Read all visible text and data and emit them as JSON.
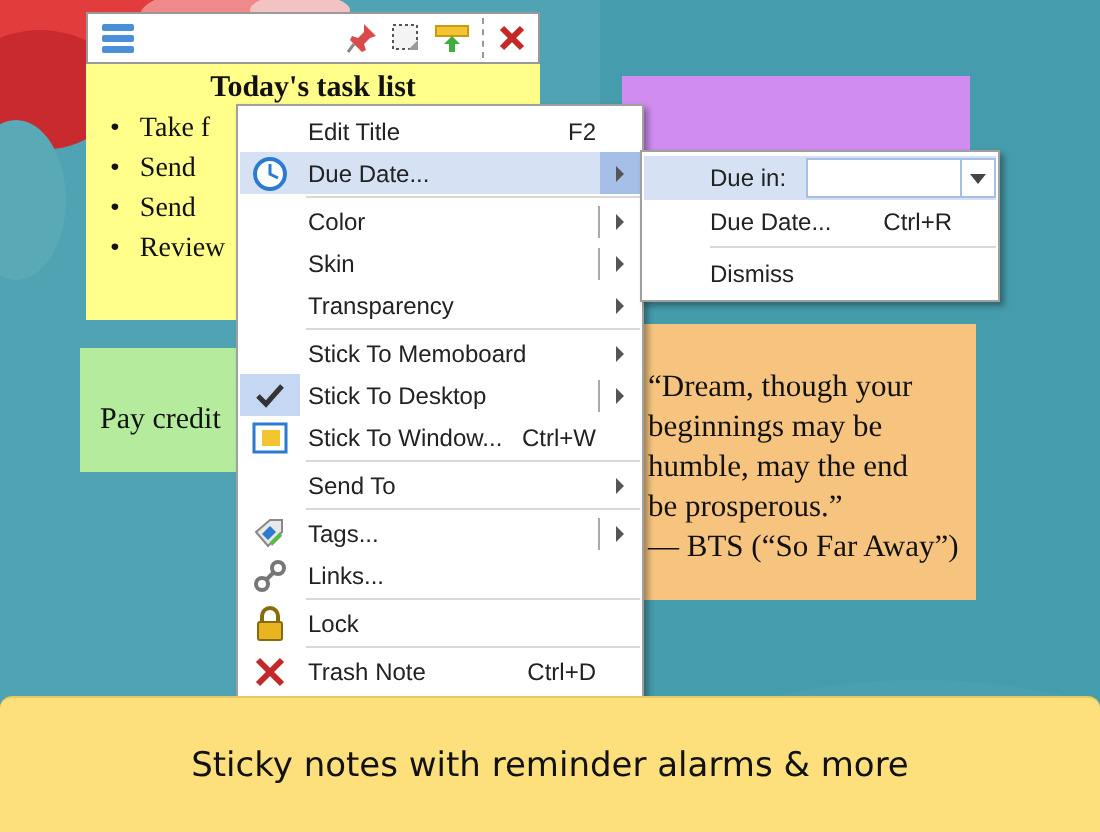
{
  "notes": [
    {
      "kind": "tasks",
      "color": "#ffff8a",
      "title": "Today's task list",
      "items": [
        {
          "bullet": "•",
          "text": "Take f"
        },
        {
          "bullet": "•",
          "text": "Send"
        },
        {
          "bullet": "•",
          "text": "Send"
        },
        {
          "bullet": "•",
          "text": "Review"
        }
      ]
    },
    {
      "kind": "blank",
      "color": "#d08cf0"
    },
    {
      "kind": "plain",
      "color": "#b5eb9c",
      "text": "Pay credit"
    },
    {
      "kind": "plain",
      "color": "#f6c47f",
      "text": "“Dream, though your\nbeginnings may be\nhumble, may the end\nbe prosperous.”\n— BTS (“So Far Away”)"
    }
  ],
  "menu": [
    {
      "label": "Edit Title",
      "shortcut": "F2",
      "submenu": false,
      "split": false,
      "separator_before": false,
      "selected": false,
      "checked": false
    },
    {
      "label": "Due Date...",
      "submenu": true,
      "split": false,
      "separator_before": false,
      "selected": true,
      "checked": false
    },
    {
      "label": "Color",
      "submenu": true,
      "split": true,
      "separator_before": true,
      "selected": false,
      "checked": false
    },
    {
      "label": "Skin",
      "submenu": true,
      "split": true,
      "separator_before": false,
      "selected": false,
      "checked": false
    },
    {
      "label": "Transparency",
      "submenu": true,
      "split": false,
      "separator_before": false,
      "selected": false,
      "checked": false
    },
    {
      "label": "Stick To Memoboard",
      "submenu": true,
      "split": false,
      "separator_before": true,
      "selected": false,
      "checked": false
    },
    {
      "label": "Stick To Desktop",
      "submenu": true,
      "split": true,
      "separator_before": false,
      "selected": false,
      "checked": true
    },
    {
      "label": "Stick To Window...",
      "shortcut": "Ctrl+W",
      "submenu": false,
      "split": false,
      "separator_before": false,
      "selected": false,
      "checked": false
    },
    {
      "label": "Send To",
      "submenu": true,
      "split": false,
      "separator_before": true,
      "selected": false,
      "checked": false
    },
    {
      "label": "Tags...",
      "submenu": true,
      "split": true,
      "separator_before": true,
      "selected": false,
      "checked": false
    },
    {
      "label": "Links...",
      "submenu": false,
      "split": false,
      "separator_before": false,
      "selected": false,
      "checked": false
    },
    {
      "label": "Lock",
      "submenu": false,
      "split": false,
      "separator_before": true,
      "selected": false,
      "checked": false
    },
    {
      "label": "Trash Note",
      "shortcut": "Ctrl+D",
      "submenu": false,
      "split": false,
      "separator_before": true,
      "selected": false,
      "checked": false
    }
  ],
  "submenu": [
    {
      "kind": "combo",
      "label": "Due in:",
      "selected": true,
      "separator_before": false
    },
    {
      "kind": "item",
      "label": "Due Date...",
      "shortcut": "Ctrl+R",
      "selected": false,
      "separator_before": false
    },
    {
      "kind": "item",
      "label": "Dismiss",
      "selected": false,
      "separator_before": true
    }
  ],
  "banner": {
    "text": "Sticky notes with reminder alarms & more"
  }
}
